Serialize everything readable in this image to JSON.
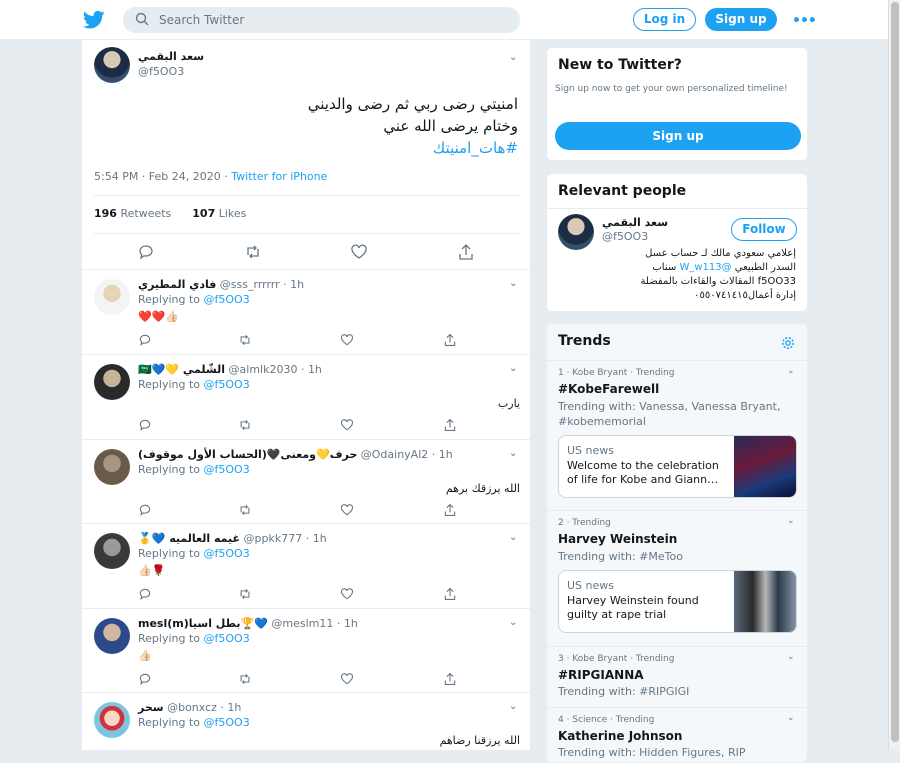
{
  "header": {
    "search_placeholder": "Search Twitter",
    "login": "Log in",
    "signup": "Sign up"
  },
  "tweet": {
    "author_name": "سعد البقمي",
    "author_handle": "@f5OO3",
    "text_line1": "امنيتي رضى ربي ثم رضى والديني",
    "text_line2": "وختام يرضى الله عني",
    "hashtag": "#هات_امنيتك",
    "time": "5:54 PM · Feb 24, 2020 · ",
    "source": "Twitter for iPhone",
    "retweets_count": "196",
    "retweets_label": " Retweets",
    "likes_count": "107",
    "likes_label": " Likes"
  },
  "replies": [
    {
      "name": "فادي المطيري",
      "handle": "@sss_rrrrrr · 1h",
      "replying": "Replying to ",
      "to": "@f5OO3",
      "text": "❤️❤️👍🏻",
      "ltr": true
    },
    {
      "name": "🇸🇦💙💛 الشّلمي",
      "handle": "@almlk2030 · 1h",
      "replying": "Replying to ",
      "to": "@f5OO3",
      "text": "يارب",
      "ltr": false
    },
    {
      "name": "حرف💛ومعنى🖤(الحساب الأول موقوف)",
      "handle": "@OdainyAl2 · 1h",
      "replying": "Replying to ",
      "to": "@f5OO3",
      "text": "الله يرزقك برهم",
      "ltr": false
    },
    {
      "name": "🥇💙 غيمه العالميه",
      "handle": "@ppkk777 · 1h",
      "replying": "Replying to ",
      "to": "@f5OO3",
      "text": "👍🏻🌹",
      "ltr": true
    },
    {
      "name": "mesl(m)بطل اسيا🏆💙",
      "handle": "@meslm11 · 1h",
      "replying": "Replying to ",
      "to": "@f5OO3",
      "text": "👍🏻",
      "ltr": true
    },
    {
      "name": "سحر",
      "handle": "@bonxcz · 1h",
      "replying": "Replying to ",
      "to": "@f5OO3",
      "text": "الله يرزقنا رضاهم",
      "ltr": false
    }
  ],
  "new_to_twitter": {
    "title": "New to Twitter?",
    "subtitle": "Sign up now to get your own personalized timeline!",
    "button": "Sign up"
  },
  "relevant": {
    "title": "Relevant people",
    "name": "سعد البقمي",
    "handle": "@f5OO3",
    "follow": "Follow",
    "bio_line1": "إعلامي سعودي مالك لـ حساب عسل",
    "bio_line2_a": "السدر الطبيعي ",
    "bio_line2_mention": "@W_w113",
    "bio_line2_b": " سناب",
    "bio_line3": "f5OO33 المقالات والقاءات بالمفضلة",
    "bio_line4": "إدارة أعمال٠٥٥٠٧٤١٤١٥"
  },
  "trends": {
    "title": "Trends",
    "items": [
      {
        "meta": "1 · Kobe Bryant · Trending",
        "name": "#KobeFarewell",
        "with": "Trending with: Vanessa, Vanessa Bryant, #kobememorial",
        "card_tag": "US news",
        "card_title": "Welcome to the celebration of life for Kobe and Giann…"
      },
      {
        "meta": "2 · Trending",
        "name": "Harvey Weinstein",
        "with": "Trending with: #MeToo",
        "card_tag": "US news",
        "card_title": "Harvey Weinstein found guilty at rape trial"
      },
      {
        "meta": "3 · Kobe Bryant · Trending",
        "name": "#RIPGIANNA",
        "with": "Trending with: #RIPGIGI"
      },
      {
        "meta": "4 · Science · Trending",
        "name": "Katherine Johnson",
        "with": "Trending with: Hidden Figures, RIP"
      }
    ]
  },
  "colors": {
    "accent": "#1da1f2",
    "background": "#e6ecf0",
    "heart": "#e0245e"
  }
}
